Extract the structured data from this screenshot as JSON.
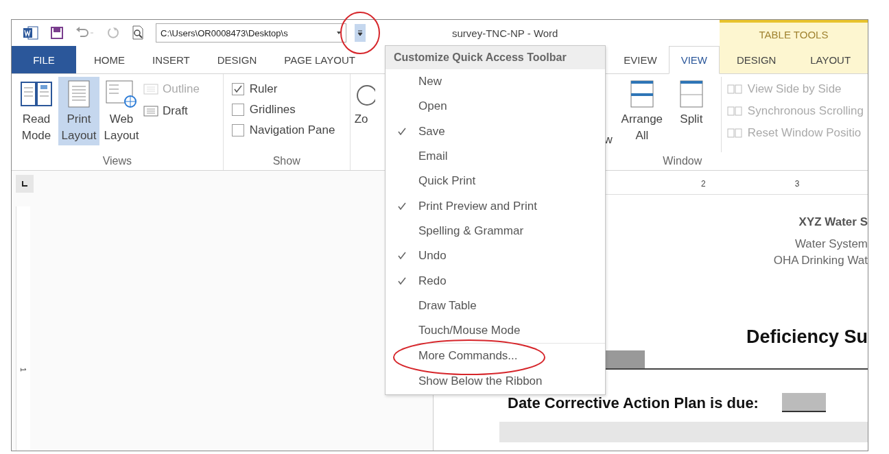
{
  "qat": {
    "path": "C:\\Users\\OR0008473\\Desktop\\s",
    "customize_selected": true
  },
  "window": {
    "title": "survey-TNC-NP - Word"
  },
  "tabs": [
    {
      "label": "FILE",
      "kind": "file",
      "selected": false
    },
    {
      "label": "HOME",
      "kind": "tab",
      "selected": false
    },
    {
      "label": "INSERT",
      "kind": "tab",
      "selected": false
    },
    {
      "label": "DESIGN",
      "kind": "tab",
      "selected": false
    },
    {
      "label": "PAGE LAYOUT",
      "kind": "tab",
      "selected": false
    }
  ],
  "tabs_right": [
    {
      "label": "EVIEW",
      "selected": false
    },
    {
      "label": "VIEW",
      "selected": true
    }
  ],
  "contextual": {
    "title": "TABLE TOOLS",
    "tabs": [
      {
        "label": "DESIGN",
        "selected": false
      },
      {
        "label": "LAYOUT",
        "selected": false
      }
    ]
  },
  "views": {
    "label": "Views",
    "large": [
      {
        "label": "Read Mode",
        "kind": "book",
        "selected": false
      },
      {
        "label": "Print Layout",
        "kind": "page",
        "selected": true
      },
      {
        "label": "Web Layout",
        "kind": "web",
        "selected": false
      }
    ],
    "small": [
      {
        "label": "Outline",
        "disabled": true
      },
      {
        "label": "Draft",
        "disabled": false
      }
    ]
  },
  "show": {
    "label": "Show",
    "checks": [
      {
        "label": "Ruler",
        "checked": true
      },
      {
        "label": "Gridlines",
        "checked": false
      },
      {
        "label": "Navigation Pane",
        "checked": false
      }
    ]
  },
  "zoom": {
    "label": "Zo"
  },
  "window_group": {
    "label": "Window",
    "fragment": "w",
    "large": [
      {
        "label": "Arrange All",
        "kind": "arrange"
      },
      {
        "label": "Split",
        "kind": "split"
      }
    ],
    "small": [
      {
        "label": "View Side by Side",
        "disabled": true
      },
      {
        "label": "Synchronous Scrolling",
        "disabled": true
      },
      {
        "label": "Reset Window Positio",
        "disabled": true
      }
    ]
  },
  "ruler": {
    "h_numbers": [
      "2",
      "3"
    ],
    "v_numbers": [
      "1"
    ]
  },
  "document": {
    "org": "XYZ Water S",
    "line_1": "Water System",
    "line_2": "OHA Drinking Wat",
    "title": "Deficiency Su",
    "due_label": "Date Corrective Action Plan is due:"
  },
  "menu": {
    "title": "Customize Quick Access Toolbar",
    "items": [
      {
        "label": "New",
        "checked": false
      },
      {
        "label": "Open",
        "checked": false
      },
      {
        "label": "Save",
        "checked": true
      },
      {
        "label": "Email",
        "checked": false
      },
      {
        "label": "Quick Print",
        "checked": false
      },
      {
        "label": "Print Preview and Print",
        "checked": true
      },
      {
        "label": "Spelling & Grammar",
        "checked": false
      },
      {
        "label": "Undo",
        "checked": true
      },
      {
        "label": "Redo",
        "checked": true
      },
      {
        "label": "Draw Table",
        "checked": false
      },
      {
        "label": "Touch/Mouse Mode",
        "checked": false
      }
    ],
    "footer_items": [
      {
        "label": "More Commands..."
      },
      {
        "label": "Show Below the Ribbon"
      }
    ]
  }
}
